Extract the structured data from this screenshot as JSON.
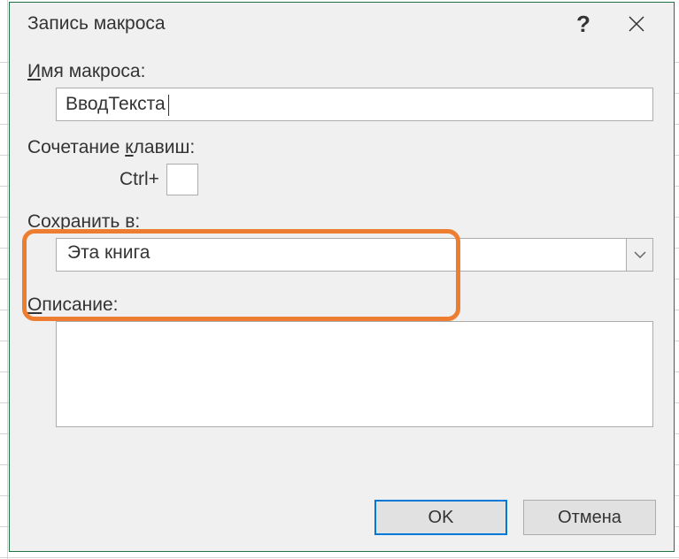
{
  "dialog": {
    "title": "Запись макроса",
    "labels": {
      "macroName": "мя макроса:",
      "macroName_prefix": "И",
      "shortcut_prefix_underline": "к",
      "shortcut_before": "Сочетание ",
      "shortcut_after": "лавиш:",
      "ctrlPlus": "Ctrl+",
      "saveIn_before": "Сохранить ",
      "saveIn_underline": "в",
      "saveIn_after": ":",
      "description_prefix": "О",
      "description_after": "писание:"
    },
    "values": {
      "macroName": "ВводТекста",
      "shortcutKey": "",
      "saveIn": "Эта книга",
      "description": ""
    },
    "buttons": {
      "ok": "OK",
      "cancel": "Отмена"
    }
  }
}
